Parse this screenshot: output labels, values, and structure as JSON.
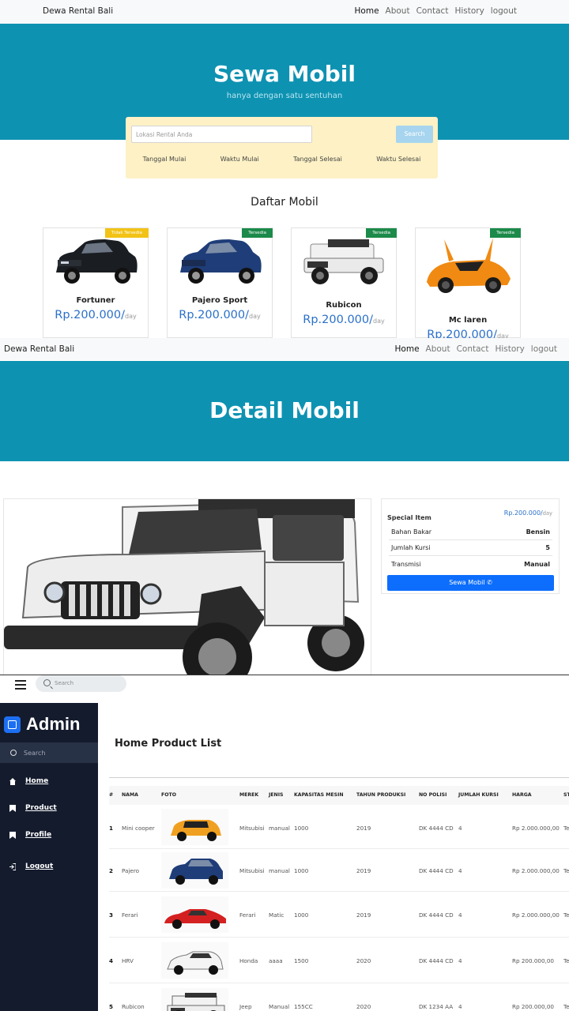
{
  "panel1": {
    "nav": {
      "brand": "Dewa Rental Bali",
      "links": [
        "Home",
        "About",
        "Contact",
        "History",
        "logout"
      ]
    },
    "hero": {
      "title": "Sewa Mobil",
      "subtitle": "hanya dengan satu sentuhan"
    },
    "search": {
      "placeholder": "Lokasi Rental Anda",
      "button": "Search",
      "labels": [
        "Tanggal Mulai",
        "Waktu Mulai",
        "Tanggal Selesai",
        "Waktu Selesai"
      ]
    },
    "section_title": "Daftar Mobil",
    "cars": [
      {
        "badge": "Tidak Tersedia",
        "name": "Fortuner",
        "price": "Rp.200.000/",
        "unit": "day",
        "color": "#1a1d22"
      },
      {
        "badge": "Tersedia",
        "name": "Pajero Sport",
        "price": "Rp.200.000/",
        "unit": "day",
        "color": "#1f3d78"
      },
      {
        "badge": "Tersedia",
        "name": "Rubicon",
        "price": "Rp.200.000/",
        "unit": "day",
        "color": "#eeeeee"
      },
      {
        "badge": "Tersedia",
        "name": "Mc laren",
        "price": "Rp.200.000/",
        "unit": "day",
        "color": "#f08a12"
      }
    ]
  },
  "panel2": {
    "nav": {
      "brand": "Dewa Rental Bali",
      "links": [
        "Home",
        "About",
        "Contact",
        "History",
        "logout"
      ]
    },
    "hero_title": "Detail Mobil",
    "spec": {
      "heading": "Special Item",
      "price": "Rp.200.000/",
      "unit": "day",
      "rows": [
        {
          "label": "Bahan Bakar",
          "value": "Bensin"
        },
        {
          "label": "Jumlah Kursi",
          "value": "5"
        },
        {
          "label": "Transmisi",
          "value": "Manual"
        }
      ],
      "button": "Sewa Mobil"
    }
  },
  "panel3": {
    "topbar": {
      "search_placeholder": "Search"
    },
    "sidebar": {
      "title": "Admin",
      "search_placeholder": "Search",
      "items": [
        {
          "label": "Home",
          "icon": "home-icon"
        },
        {
          "label": "Product",
          "icon": "bookmark-icon"
        },
        {
          "label": "Profile",
          "icon": "bookmark-icon"
        },
        {
          "label": "Logout",
          "icon": "logout-icon"
        }
      ]
    },
    "page_title": "Home Product List",
    "columns": [
      "#",
      "NAMA",
      "FOTO",
      "MEREK",
      "JENIS",
      "KAPASITAS MESIN",
      "TAHUN PRODUKSI",
      "NO POLISI",
      "JUMLAH KURSI",
      "HARGA",
      "ST"
    ],
    "rows": [
      {
        "no": "1",
        "nama": "Mini cooper",
        "merek": "Mitsubisi",
        "jenis": "manual",
        "kapasitas": "1000",
        "tahun": "2019",
        "polisi": "DK 4444 CD",
        "kursi": "4",
        "harga": "Rp 2.000.000,00",
        "st": "Te",
        "color": "#f0a020"
      },
      {
        "no": "2",
        "nama": "Pajero",
        "merek": "Mitsubisi",
        "jenis": "manual",
        "kapasitas": "1000",
        "tahun": "2019",
        "polisi": "DK 4444 CD",
        "kursi": "4",
        "harga": "Rp 2.000.000,00",
        "st": "Te",
        "color": "#1f3d78"
      },
      {
        "no": "3",
        "nama": "Ferari",
        "merek": "Ferari",
        "jenis": "Matic",
        "kapasitas": "1000",
        "tahun": "2019",
        "polisi": "DK 4444 CD",
        "kursi": "4",
        "harga": "Rp 2.000.000,00",
        "st": "Te",
        "color": "#d42020"
      },
      {
        "no": "4",
        "nama": "HRV",
        "merek": "Honda",
        "jenis": "aaaa",
        "kapasitas": "1500",
        "tahun": "2020",
        "polisi": "DK 4444 CD",
        "kursi": "4",
        "harga": "Rp 200.000,00",
        "st": "Te",
        "color": "#eeeeee"
      },
      {
        "no": "5",
        "nama": "Rubicon",
        "merek": "Jeep",
        "jenis": "Manual",
        "kapasitas": "155CC",
        "tahun": "2020",
        "polisi": "DK 1234 AA",
        "kursi": "4",
        "harga": "Rp 200.000,00",
        "st": "Te",
        "color": "#eeeeee"
      }
    ]
  }
}
